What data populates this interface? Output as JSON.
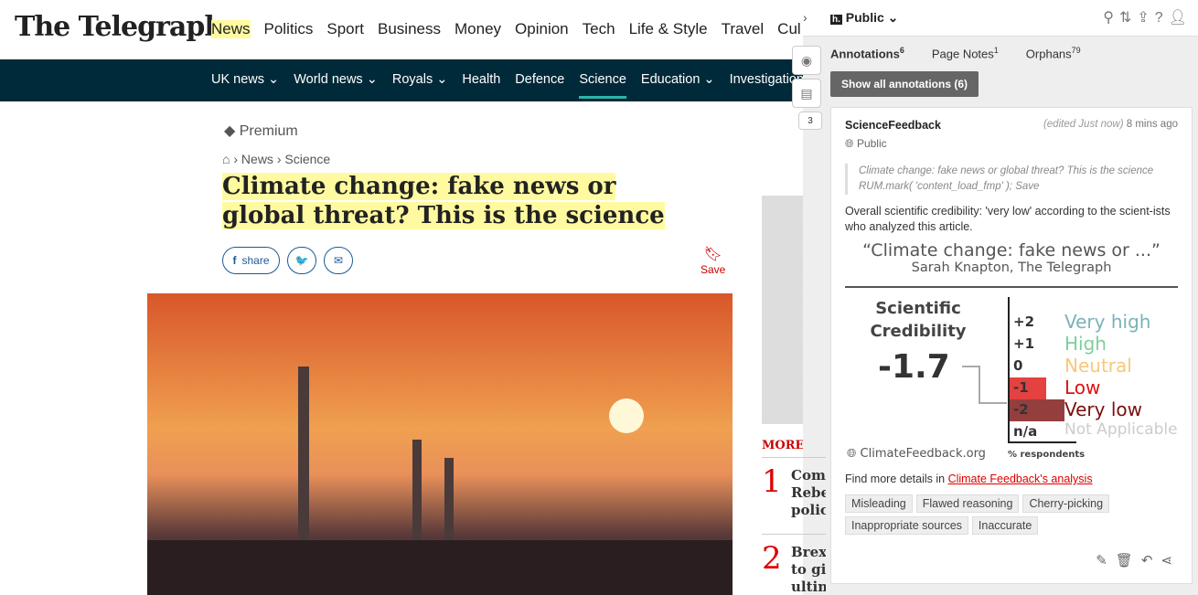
{
  "site": {
    "logo": "The Telegraph",
    "top_nav": [
      "News",
      "Politics",
      "Sport",
      "Business",
      "Money",
      "Opinion",
      "Tech",
      "Life & Style",
      "Travel",
      "Cul"
    ],
    "sub_nav": [
      "UK news ⌄",
      "World news ⌄",
      "Royals ⌄",
      "Health",
      "Defence",
      "Science",
      "Education ⌄",
      "Investigations"
    ],
    "premium": "Premium",
    "breadcrumb": [
      "News",
      "Science"
    ],
    "headline": "Climate change: fake news or global threat? This is the science",
    "share_label": "share",
    "save_label": "Save",
    "more_stories": "MORE STORIES",
    "stories": [
      {
        "n": "1",
        "text": "Comm\nRebe\npolic"
      },
      {
        "n": "2",
        "text": "Brexi\nto giv\nultim"
      }
    ]
  },
  "sidebar": {
    "group": "Public",
    "tabs": [
      {
        "label": "Annotations",
        "count": "6"
      },
      {
        "label": "Page Notes",
        "count": "1"
      },
      {
        "label": "Orphans",
        "count": "79"
      }
    ],
    "show_all": "Show all annotations (6)",
    "badge_count": "3",
    "annotation": {
      "user": "ScienceFeedback",
      "edited": "(edited Just now)",
      "time": "8 mins ago",
      "visibility": "Public",
      "quote": "Climate change: fake news or global threat? This is the science  RUM.mark( 'content_load_fmp' ); Save",
      "body": "Overall scientific credibility: 'very low' according to the scient-ists who analyzed this article.",
      "figure": {
        "title": "“Climate change: fake news or ...”",
        "subtitle": "Sarah Knapton, The Telegraph",
        "label": "Scientific Credibility",
        "score": "-1.7",
        "source": "ClimateFeedback.org",
        "axis_label": "% respondents",
        "levels": [
          {
            "v": "+2",
            "name": "Very high",
            "color": "#7ab3b8",
            "share": 0
          },
          {
            "v": "+1",
            "name": "High",
            "color": "#7dcf9a",
            "share": 0
          },
          {
            "v": "0",
            "name": "Neutral",
            "color": "#f7c87a",
            "share": 0
          },
          {
            "v": "-1",
            "name": "Low",
            "color": "#dd1111",
            "share": 0.4
          },
          {
            "v": "-2",
            "name": "Very low",
            "color": "#7a0e0e",
            "share": 0.6
          },
          {
            "v": "n/a",
            "name": "Not Applicable",
            "color": "#cccccc",
            "share": 0
          }
        ]
      },
      "details_prefix": "Find more details in ",
      "details_link": "Climate Feedback's analysis",
      "tags": [
        "Misleading",
        "Flawed reasoning",
        "Cherry-picking",
        "Inappropriate sources",
        "Inaccurate"
      ]
    }
  }
}
